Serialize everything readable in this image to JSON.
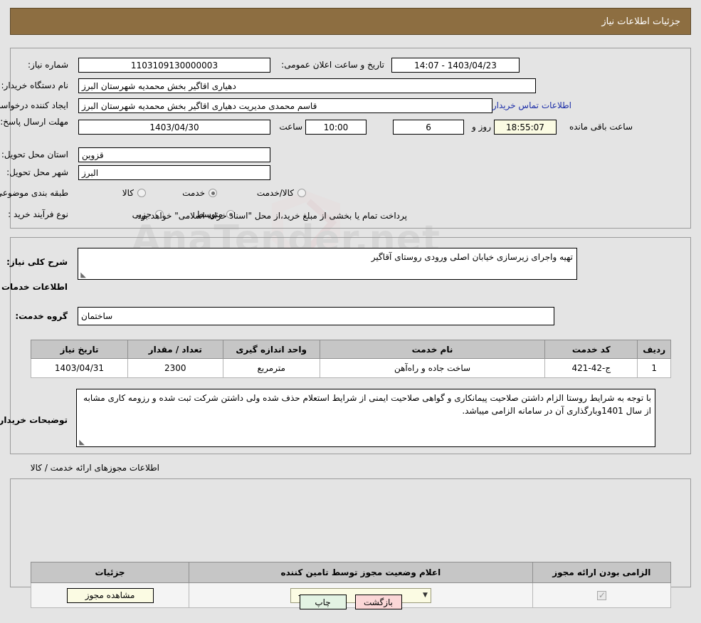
{
  "header": {
    "title": "جزئیات اطلاعات نیاز"
  },
  "need_info": {
    "need_number_label": "شماره نیاز:",
    "need_number_value": "1103109130000003",
    "public_announce_label": "تاریخ و ساعت اعلان عمومی:",
    "public_announce_value": "1403/04/23 - 14:07",
    "buyer_org_label": "نام دستگاه خریدار:",
    "buyer_org_value": "دهیاری اقاگیر بخش محمدیه شهرستان البرز",
    "requester_label": "ایجاد کننده درخواست:",
    "requester_value": "قاسم محمدی مدیریت دهیاری اقاگیر بخش محمدیه شهرستان البرز",
    "contact_link": "اطلاعات تماس خریدار",
    "deadline_label": "مهلت ارسال پاسخ: تا تاریخ:",
    "deadline_date": "1403/04/30",
    "deadline_hour_label": "ساعت",
    "deadline_hour": "10:00",
    "remaining_days": "6",
    "remaining_days_label": "روز و",
    "remaining_time": "18:55:07",
    "remaining_time_label": "ساعت باقی مانده",
    "province_label": "استان محل تحویل:",
    "province_value": "قزوین",
    "city_label": "شهر محل تحویل:",
    "city_value": "البرز",
    "category_label": "طبقه بندی موضوعی:",
    "category_options": [
      {
        "label": "کالا",
        "selected": false
      },
      {
        "label": "خدمت",
        "selected": true
      },
      {
        "label": "کالا/خدمت",
        "selected": false
      }
    ],
    "process_label": "نوع فرآیند خرید :",
    "process_options": [
      {
        "label": "جزیی",
        "selected": false
      },
      {
        "label": "متوسط",
        "selected": true
      }
    ],
    "payment_note": "پرداخت تمام یا بخشی از مبلغ خرید،از محل \"اسناد خزانه اسلامی\" خواهد بود."
  },
  "description": {
    "general_label": "شرح کلی نیاز:",
    "general_value": "تهیه واجرای زیرسازی خیابان اصلی ورودی روستای آقاگیر",
    "services_section_title": "اطلاعات خدمات مورد نیاز",
    "service_group_label": "گروه خدمت:",
    "service_group_value": "ساختمان",
    "buyer_notes_label": "توضیحات خریدار:",
    "buyer_notes_value": "با توجه به شرایط روستا الزام داشتن صلاحیت پیمانکاری و گواهی صلاحیت ایمنی از شرایط استعلام حذف شده ولی داشتن شرکت ثبت شده و رزومه کاری مشابه از سال 1401وبارگذاری آن در سامانه الزامی میباشد."
  },
  "services_table": {
    "columns": [
      "ردیف",
      "کد خدمت",
      "نام خدمت",
      "واحد اندازه گیری",
      "تعداد / مقدار",
      "تاریخ نیاز"
    ],
    "rows": [
      {
        "row": "1",
        "code": "ج-42-421",
        "name": "ساخت جاده و راه‌آهن",
        "unit": "مترمربع",
        "quantity": "2300",
        "need_date": "1403/04/31"
      }
    ]
  },
  "permits": {
    "section_title": "اطلاعات مجوزهای ارائه خدمت / کالا",
    "columns": [
      "الزامی بودن ارائه مجوز",
      "اعلام وضعیت مجوز توسط تامین کننده",
      "جزئیات"
    ],
    "rows": [
      {
        "required": true,
        "status_value": "--",
        "details_button": "مشاهده مجوز"
      }
    ]
  },
  "footer": {
    "print_label": "چاپ",
    "back_label": "بازگشت"
  },
  "watermark": {
    "text": "AnaTender.net"
  },
  "colors": {
    "header_bg": "#8d6e41",
    "link": "#1c2ea8",
    "table_header_bg": "#c6c6c6",
    "print_btn_bg": "#e3f3e3",
    "back_btn_bg": "#fbd7d7",
    "highlight_field_bg": "#fbfbe3"
  }
}
